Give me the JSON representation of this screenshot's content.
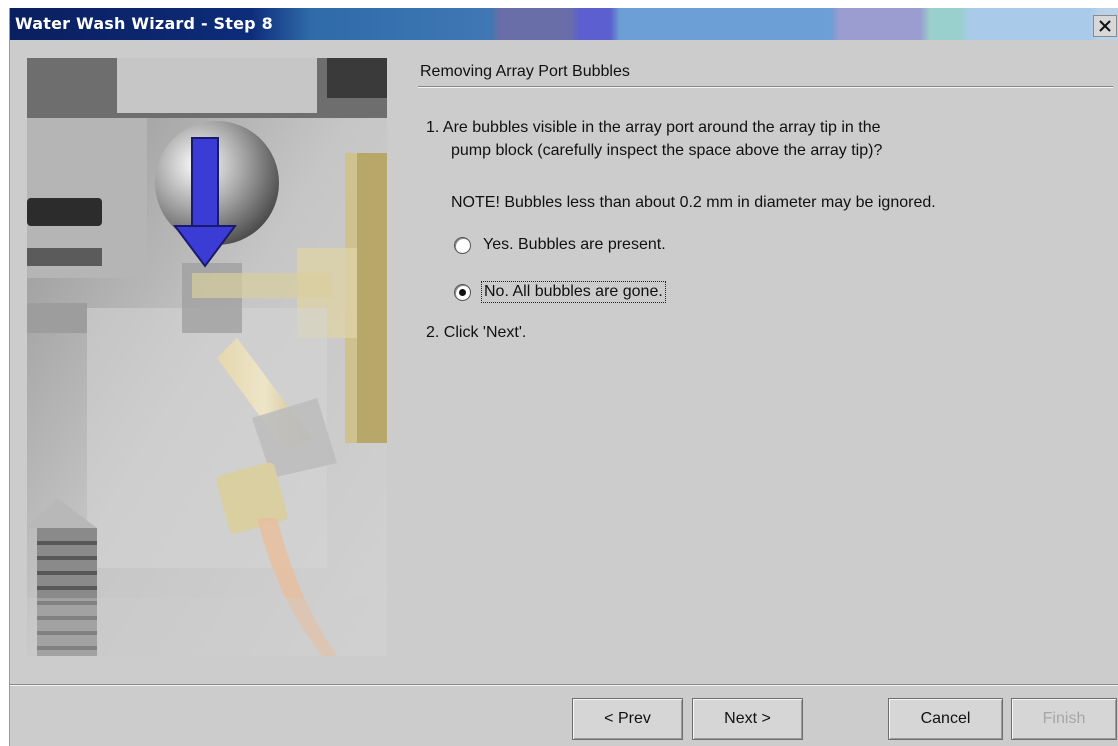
{
  "window": {
    "title": "Water Wash Wizard - Step 8",
    "close_symbol": "✕"
  },
  "photo": {
    "subject": "pump block with downward arrow",
    "arrow_color": "#3b3bd6"
  },
  "content": {
    "section_title": "Removing Array Port Bubbles",
    "step1_line1": "1. Are bubbles visible in the array port around the array tip in the",
    "step1_line2": "pump block (carefully inspect the space above the array tip)?",
    "note": "NOTE!  Bubbles less than about 0.2 mm in diameter may be ignored.",
    "options": [
      {
        "label": "Yes. Bubbles are present.",
        "selected": false
      },
      {
        "label": "No. All bubbles are gone.",
        "selected": true
      }
    ],
    "step2": "2. Click 'Next'."
  },
  "buttons": {
    "prev": "< Prev",
    "next": "Next >",
    "cancel": "Cancel",
    "finish": "Finish"
  },
  "icons": {
    "close": "close-icon",
    "radio": "radio-button-icon"
  }
}
